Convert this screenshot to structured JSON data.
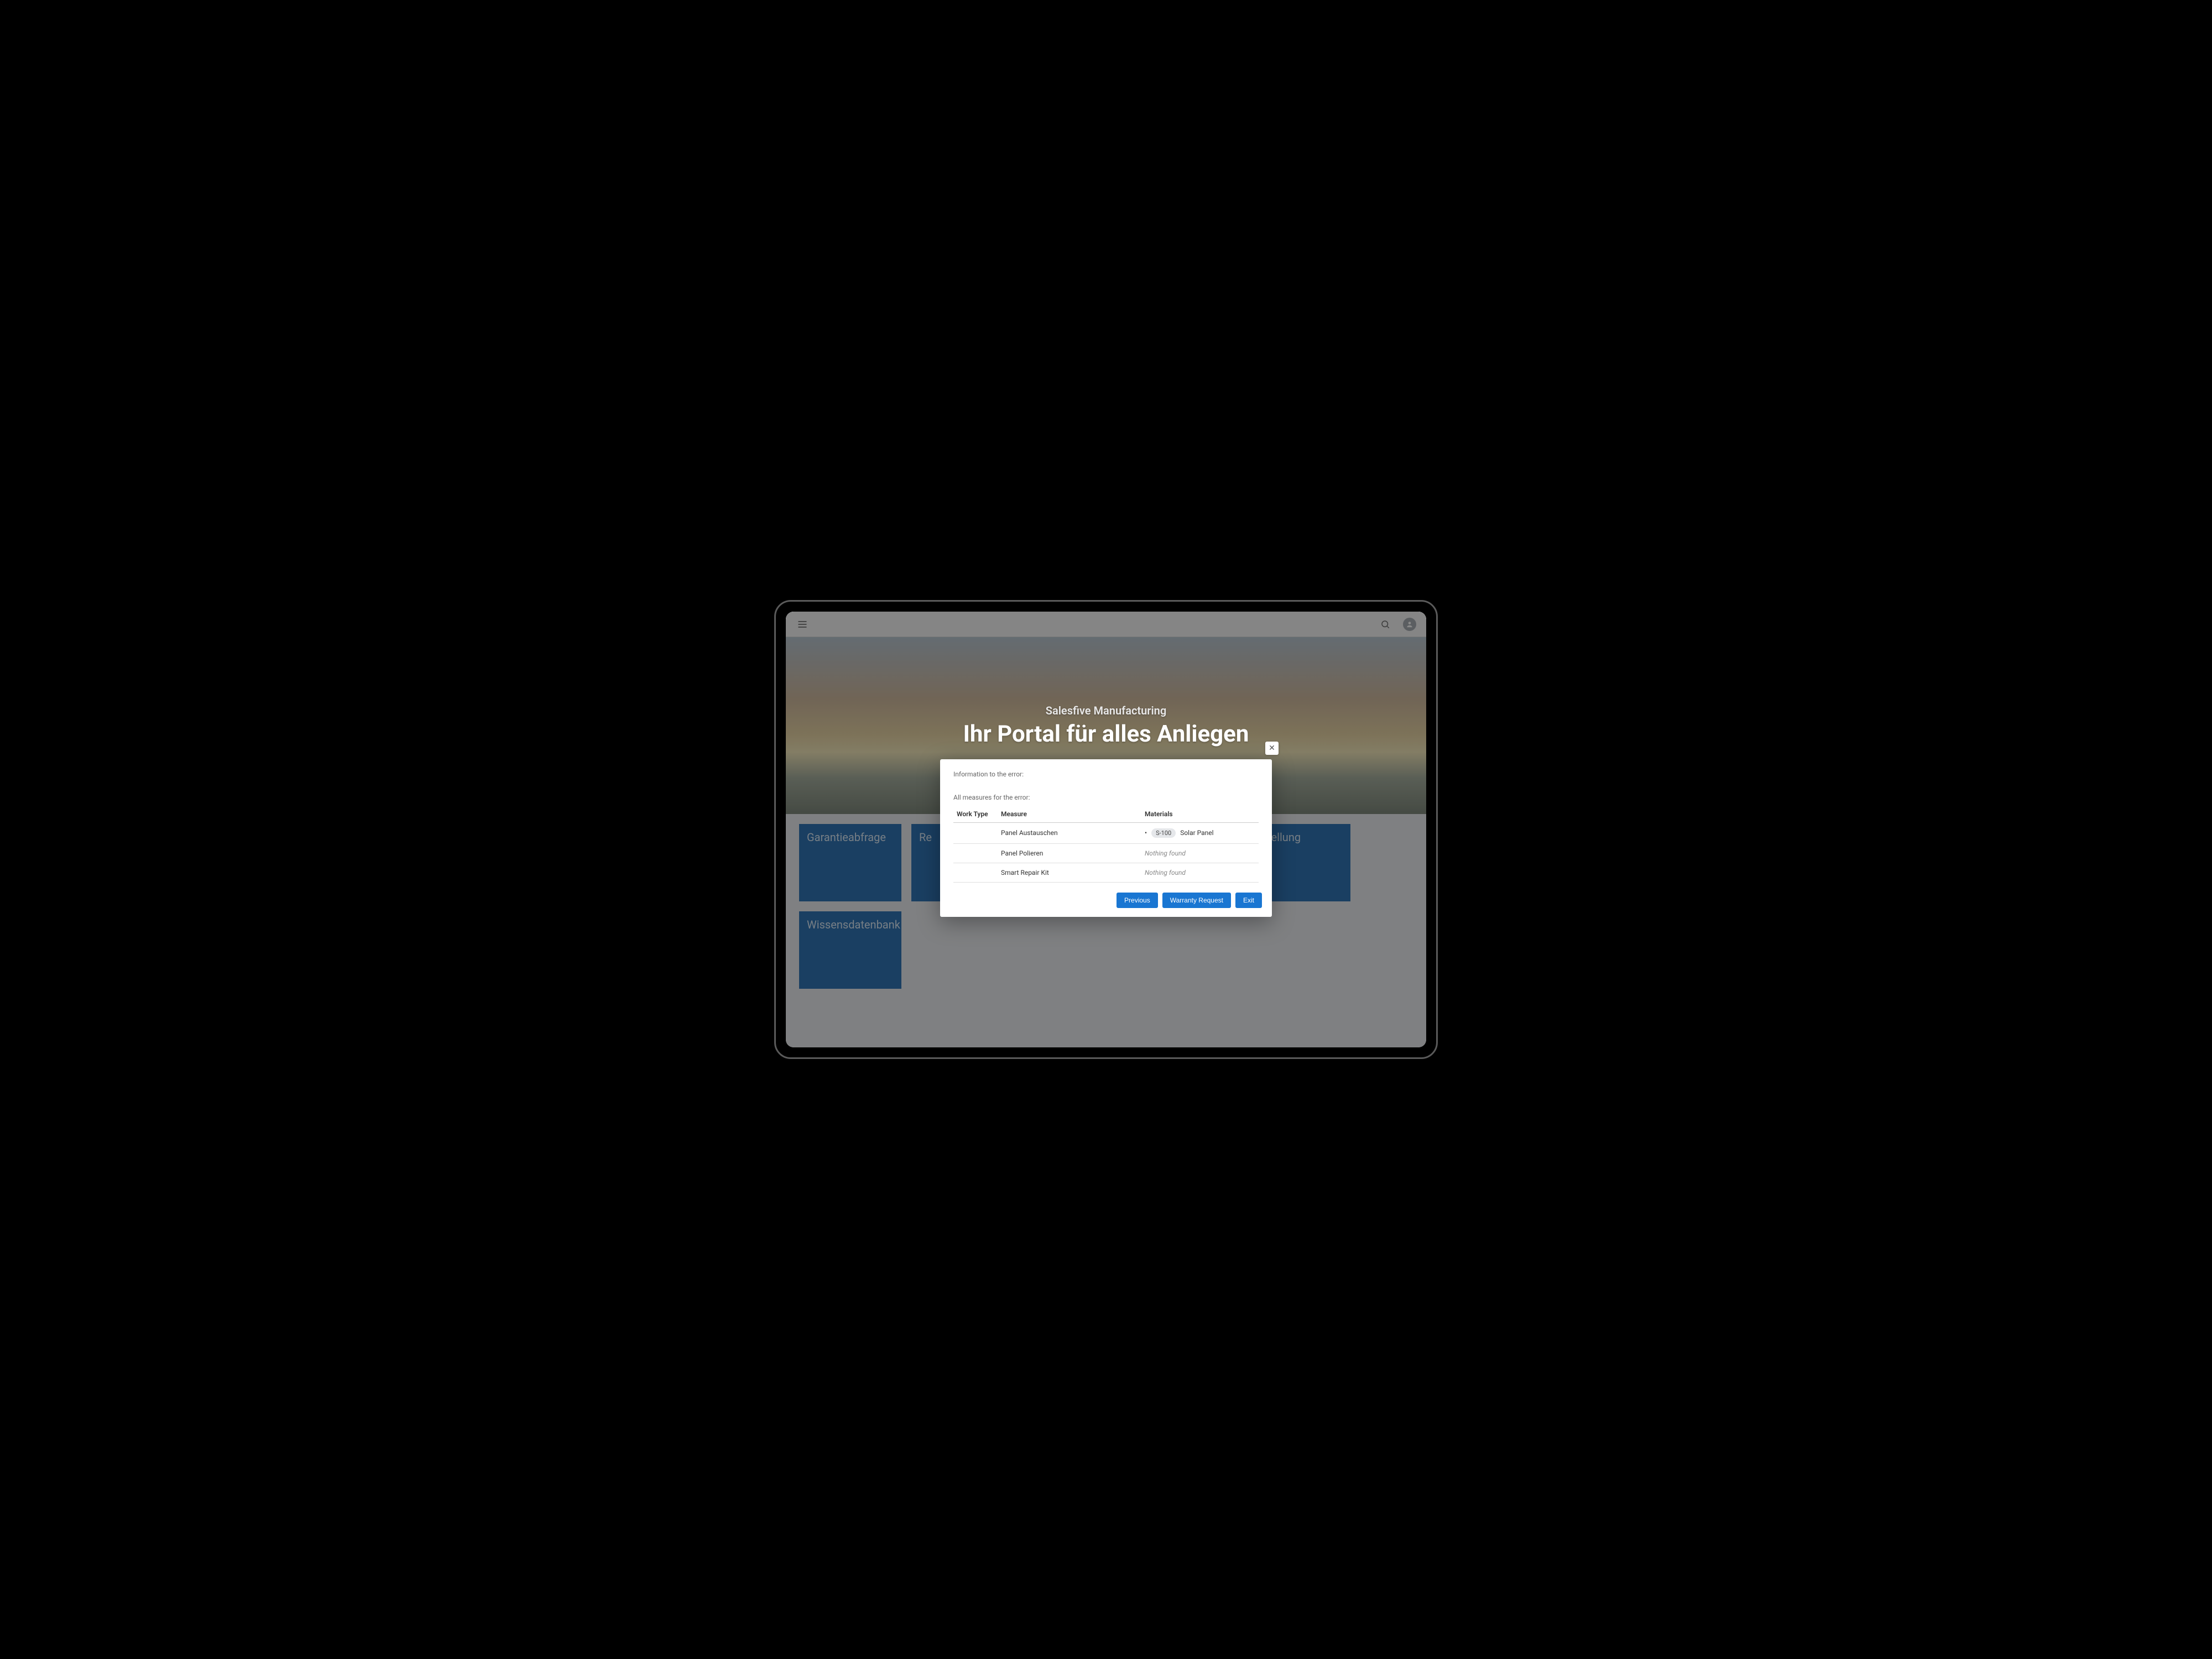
{
  "hero": {
    "subtitle": "Salesfive Manufacturing",
    "title": "Ihr Portal für alles Anliegen"
  },
  "tiles": [
    "Garantieabfrage",
    "Re",
    "",
    "",
    "estellung",
    "Wissensdatenbank"
  ],
  "modal": {
    "close_glyph": "✕",
    "info_heading": "Information to the error:",
    "measures_heading": "All measures for the error:",
    "columns": {
      "work_type": "Work Type",
      "measure": "Measure",
      "materials": "Materials"
    },
    "rows": [
      {
        "work_type": "",
        "measure": "Panel Austauschen",
        "materials": {
          "type": "item",
          "code": "S-100",
          "name": "Solar Panel"
        }
      },
      {
        "work_type": "",
        "measure": "Panel Polieren",
        "materials": {
          "type": "nothing",
          "text": "Nothing found"
        }
      },
      {
        "work_type": "",
        "measure": "Smart Repair Kit",
        "materials": {
          "type": "nothing",
          "text": "Nothing found"
        }
      }
    ],
    "actions": {
      "previous": "Previous",
      "warranty": "Warranty Request",
      "exit": "Exit"
    }
  }
}
